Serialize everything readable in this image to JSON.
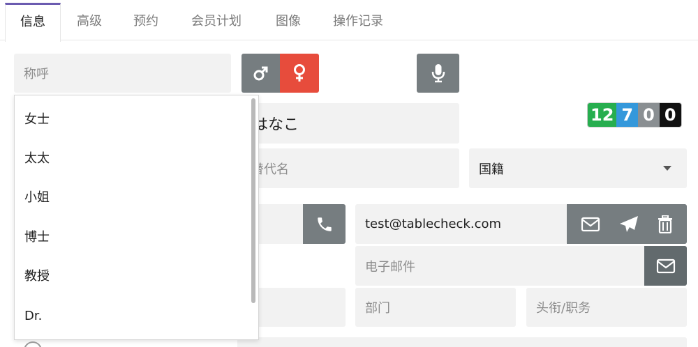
{
  "tabs": [
    {
      "label": "信息",
      "active": true
    },
    {
      "label": "高级",
      "active": false
    },
    {
      "label": "预约",
      "active": false
    },
    {
      "label": "会员计划",
      "active": false
    },
    {
      "label": "图像",
      "active": false
    },
    {
      "label": "操作记录",
      "active": false
    }
  ],
  "salutation": {
    "placeholder": "称呼"
  },
  "gender": {
    "male_icon": "male-icon",
    "female_icon": "female-icon",
    "female_color": "#e74c3c"
  },
  "voice": {
    "icon": "microphone-icon"
  },
  "name_field": {
    "value": "はなこ"
  },
  "alt_name_field": {
    "placeholder": "替代名"
  },
  "nationality": {
    "placeholder": "国籍"
  },
  "counters": [
    {
      "value": "12",
      "color": "#27ae4f"
    },
    {
      "value": "7",
      "color": "#3498db"
    },
    {
      "value": "0",
      "color": "#8a8f92"
    },
    {
      "value": "0",
      "color": "#111111"
    }
  ],
  "email1": {
    "value": "test@tablecheck.com"
  },
  "email2": {
    "placeholder": "电子邮件"
  },
  "department": {
    "placeholder": "部门"
  },
  "job_title": {
    "placeholder": "头衔/职务"
  },
  "salutation_options": [
    "女士",
    "太太",
    "小姐",
    "博士",
    "教授",
    "Dr."
  ]
}
